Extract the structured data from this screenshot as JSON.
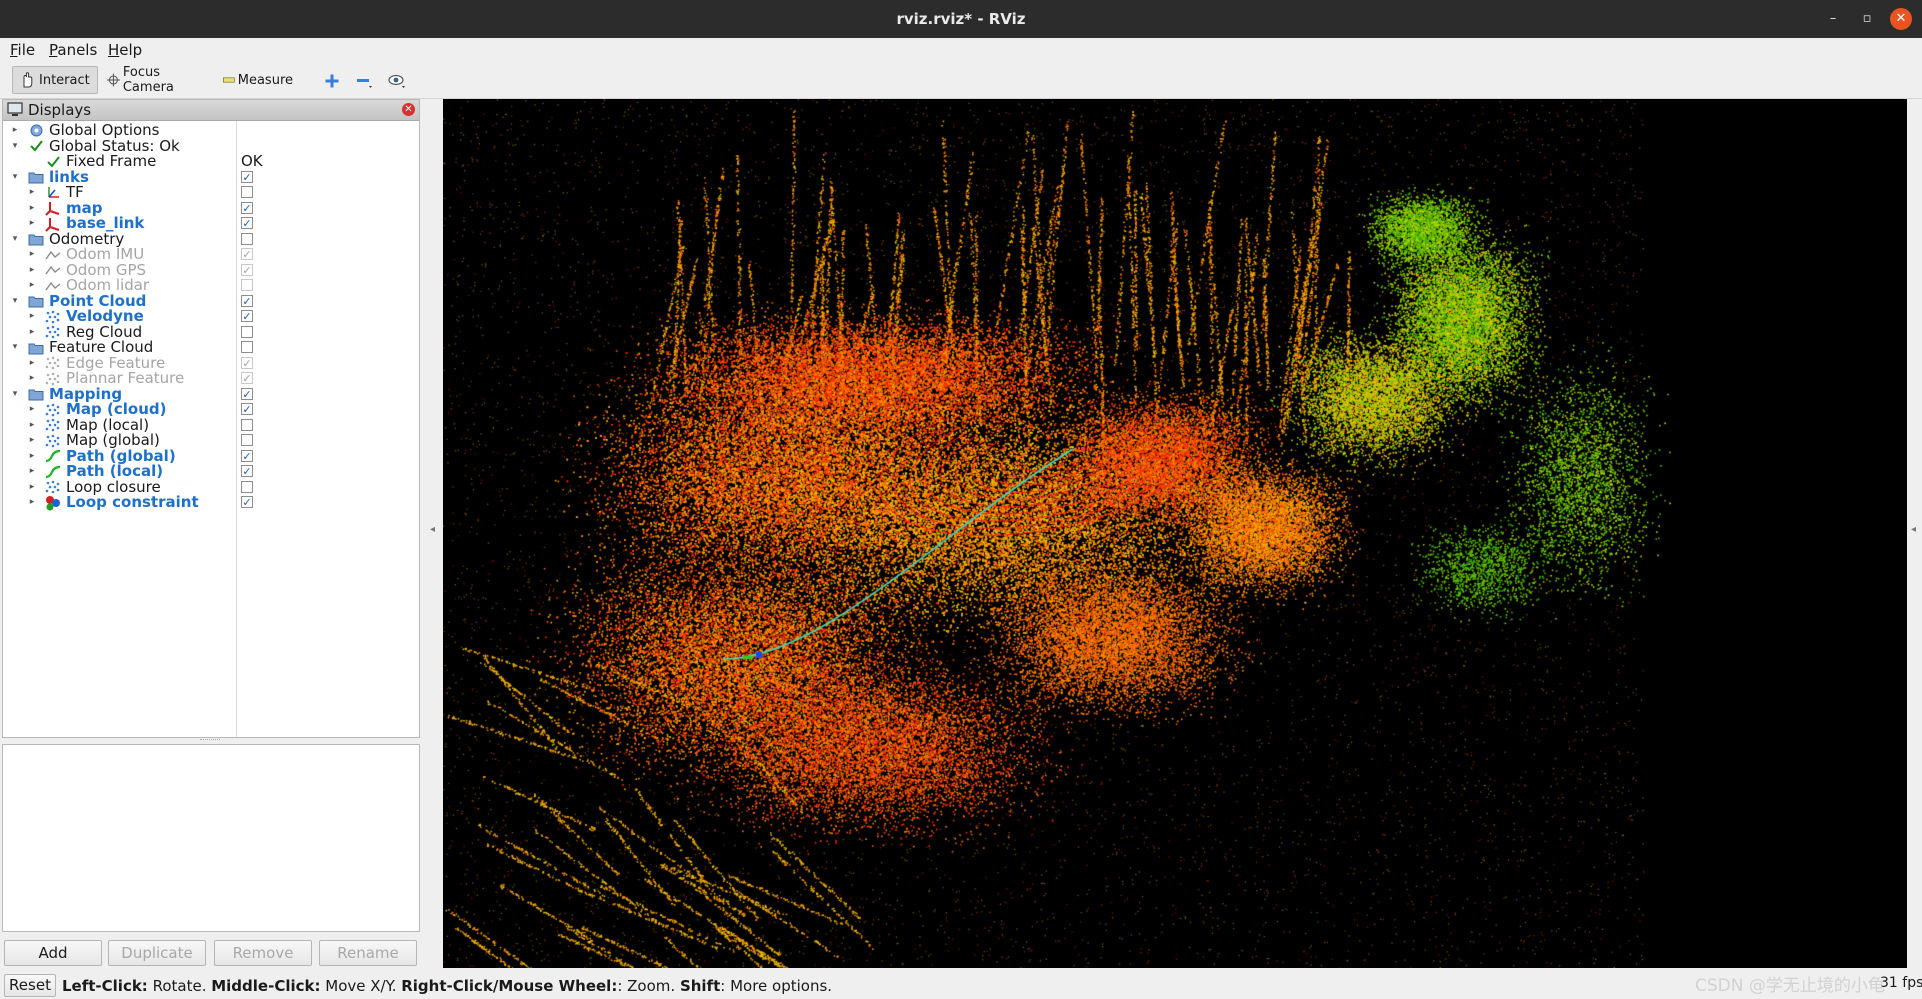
{
  "window": {
    "title": "rviz.rviz* - RViz",
    "controls": [
      "–",
      "▫",
      "✕"
    ]
  },
  "menubar": {
    "items": [
      {
        "mnemonic": "F",
        "rest": "ile"
      },
      {
        "mnemonic": "P",
        "rest": "anels"
      },
      {
        "mnemonic": "H",
        "rest": "elp"
      }
    ]
  },
  "toolbar": {
    "interact": "Interact",
    "focus_camera": "Focus Camera",
    "measure": "Measure",
    "icons": [
      "add-tool-icon",
      "remove-tool-icon",
      "view-icon"
    ]
  },
  "displays": {
    "title": "Displays",
    "rows": [
      {
        "label": "Global Options",
        "style": "normal",
        "level": 0,
        "arrow": "▸",
        "icon": "gear"
      },
      {
        "label": "Global Status: Ok",
        "style": "normal",
        "level": 0,
        "arrow": "▾",
        "icon": "check"
      },
      {
        "label": "Fixed Frame",
        "style": "normal",
        "level": 1,
        "arrow": "",
        "icon": "check",
        "value": "OK"
      },
      {
        "label": "links",
        "style": "blue",
        "level": 0,
        "arrow": "▾",
        "icon": "folder",
        "checked": true
      },
      {
        "label": "TF",
        "style": "normal",
        "level": 1,
        "arrow": "▸",
        "icon": "tf",
        "checked": false
      },
      {
        "label": "map",
        "style": "blue",
        "level": 1,
        "arrow": "▸",
        "icon": "axes",
        "checked": true
      },
      {
        "label": "base_link",
        "style": "blue",
        "level": 1,
        "arrow": "▸",
        "icon": "axes",
        "checked": true
      },
      {
        "label": "Odometry",
        "style": "normal",
        "level": 0,
        "arrow": "▾",
        "icon": "folder",
        "checked": false
      },
      {
        "label": "Odom IMU",
        "style": "gray",
        "level": 1,
        "arrow": "▸",
        "icon": "odom",
        "checked": true,
        "dim": true
      },
      {
        "label": "Odom GPS",
        "style": "gray",
        "level": 1,
        "arrow": "▸",
        "icon": "odom",
        "checked": true,
        "dim": true
      },
      {
        "label": "Odom lidar",
        "style": "gray",
        "level": 1,
        "arrow": "▸",
        "icon": "odom",
        "checked": false,
        "dim": true
      },
      {
        "label": "Point Cloud",
        "style": "blue",
        "level": 0,
        "arrow": "▾",
        "icon": "folder",
        "checked": true
      },
      {
        "label": "Velodyne",
        "style": "blue",
        "level": 1,
        "arrow": "▸",
        "icon": "cloud",
        "checked": true
      },
      {
        "label": "Reg Cloud",
        "style": "normal",
        "level": 1,
        "arrow": "▸",
        "icon": "cloud",
        "checked": false
      },
      {
        "label": "Feature Cloud",
        "style": "normal",
        "level": 0,
        "arrow": "▾",
        "icon": "folder",
        "checked": false
      },
      {
        "label": "Edge Feature",
        "style": "gray",
        "level": 1,
        "arrow": "▸",
        "icon": "cloud-gray",
        "checked": true,
        "dim": true
      },
      {
        "label": "Plannar Feature",
        "style": "gray",
        "level": 1,
        "arrow": "▸",
        "icon": "cloud-gray",
        "checked": true,
        "dim": true
      },
      {
        "label": "Mapping",
        "style": "blue",
        "level": 0,
        "arrow": "▾",
        "icon": "folder",
        "checked": true
      },
      {
        "label": "Map (cloud)",
        "style": "blue",
        "level": 1,
        "arrow": "▸",
        "icon": "cloud",
        "checked": true
      },
      {
        "label": "Map (local)",
        "style": "normal",
        "level": 1,
        "arrow": "▸",
        "icon": "cloud",
        "checked": false
      },
      {
        "label": "Map (global)",
        "style": "normal",
        "level": 1,
        "arrow": "▸",
        "icon": "cloud",
        "checked": false
      },
      {
        "label": "Path (global)",
        "style": "blue",
        "level": 1,
        "arrow": "▸",
        "icon": "path",
        "checked": true
      },
      {
        "label": "Path (local)",
        "style": "blue",
        "level": 1,
        "arrow": "▸",
        "icon": "path",
        "checked": true
      },
      {
        "label": "Loop closure",
        "style": "normal",
        "level": 1,
        "arrow": "▸",
        "icon": "cloud",
        "checked": false
      },
      {
        "label": "Loop constraint",
        "style": "blue",
        "level": 1,
        "arrow": "▸",
        "icon": "marker",
        "checked": true
      }
    ]
  },
  "buttons": {
    "add": "Add",
    "duplicate": "Duplicate",
    "remove": "Remove",
    "rename": "Rename"
  },
  "status": {
    "reset": "Reset",
    "help_parts": [
      {
        "bold": true,
        "text": "Left-Click:"
      },
      {
        "bold": false,
        "text": " Rotate. "
      },
      {
        "bold": true,
        "text": "Middle-Click:"
      },
      {
        "bold": false,
        "text": " Move X/Y. "
      },
      {
        "bold": true,
        "text": "Right-Click/Mouse Wheel:"
      },
      {
        "bold": false,
        "text": ": Zoom. "
      },
      {
        "bold": true,
        "text": "Shift"
      },
      {
        "bold": false,
        "text": ": More options."
      }
    ],
    "fps": "31 fps",
    "watermark": "CSDN @学无止境的小龟"
  },
  "viewport": {
    "background": "#000000",
    "point_colors": [
      "#ff2a00",
      "#ff5a00",
      "#ff8c00",
      "#ffb000",
      "#e6c800",
      "#b4dc00",
      "#78c800",
      "#3cb400"
    ],
    "path_color": "#40d8c0",
    "loop_color": "#ff2020"
  }
}
